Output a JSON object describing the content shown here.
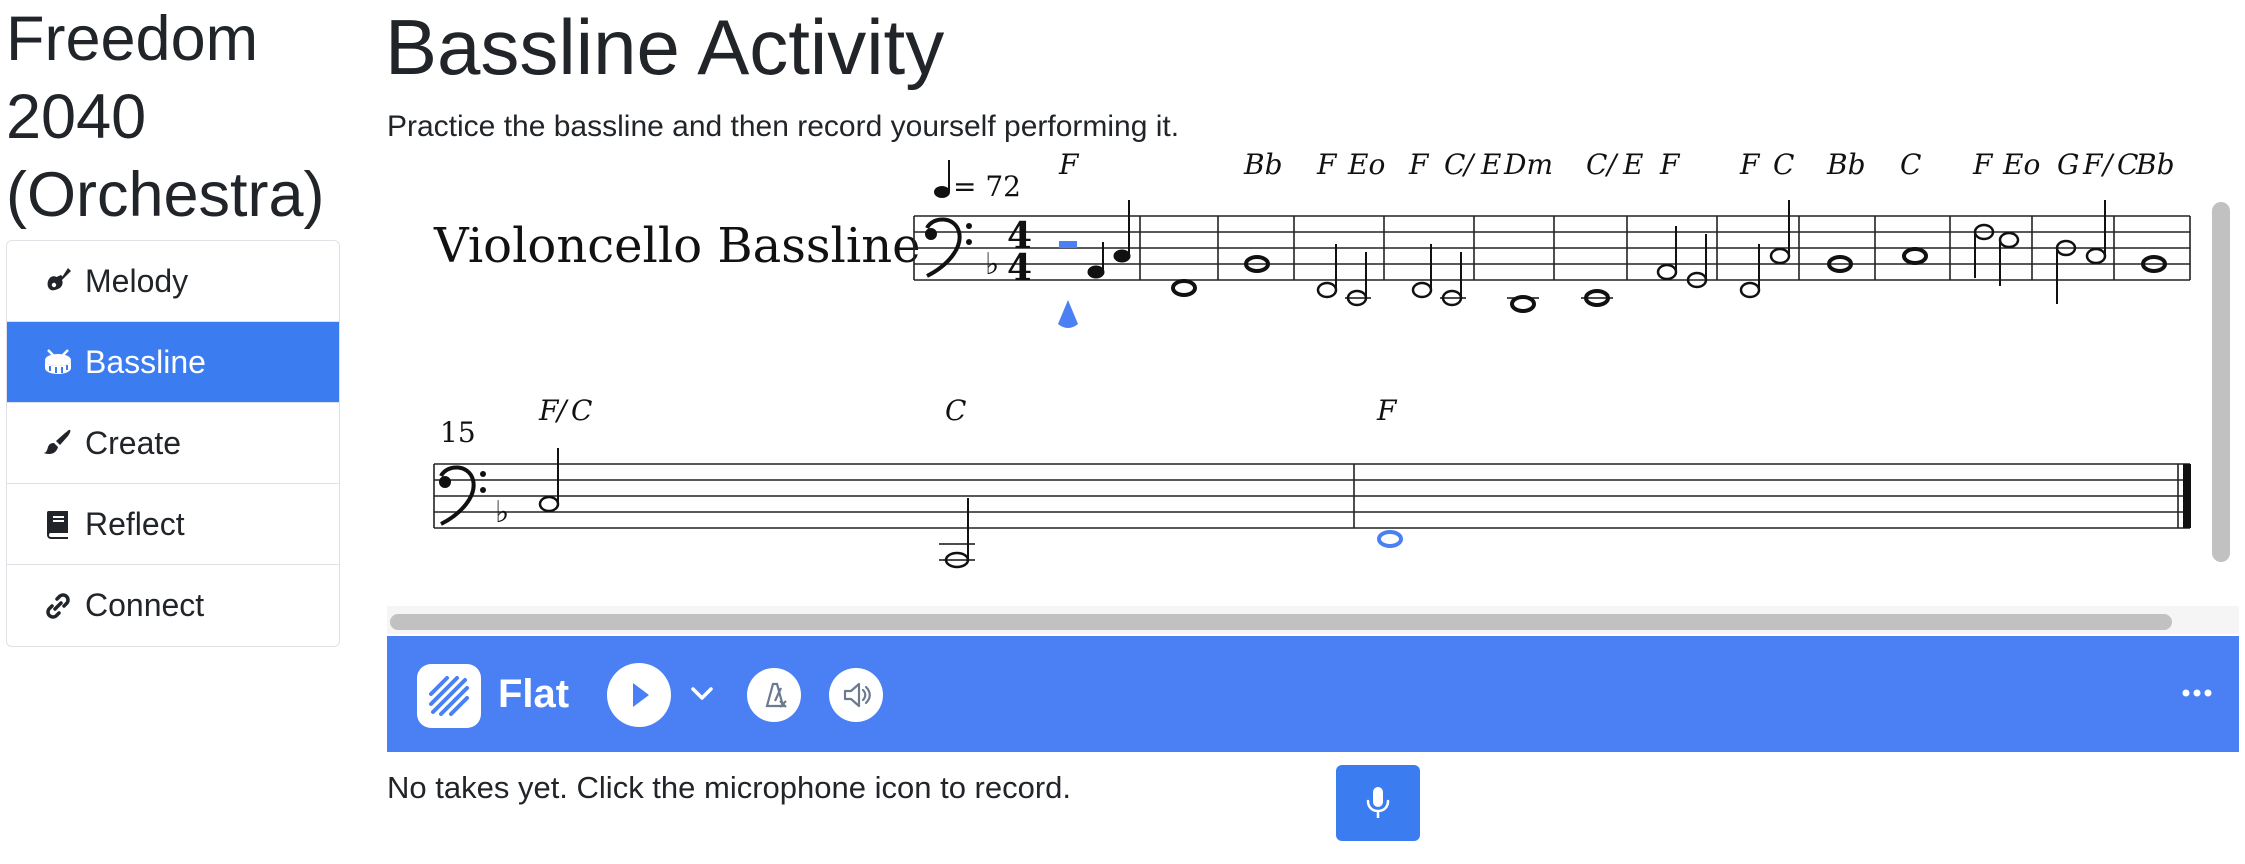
{
  "app": {
    "title": "Freedom 2040 (Orchestra)"
  },
  "sidebar": {
    "items": [
      {
        "label": "Melody",
        "icon": "guitar-icon",
        "active": false
      },
      {
        "label": "Bassline",
        "icon": "drum-icon",
        "active": true
      },
      {
        "label": "Create",
        "icon": "paintbrush-icon",
        "active": false
      },
      {
        "label": "Reflect",
        "icon": "book-icon",
        "active": false
      },
      {
        "label": "Connect",
        "icon": "link-icon",
        "active": false
      }
    ]
  },
  "main": {
    "title": "Bassline Activity",
    "instructions": "Practice the bassline and then record yourself performing it.",
    "score": {
      "instrument": "Violoncello Bassline",
      "tempo": "= 72",
      "time_signature": "4/4",
      "measure_number": "15",
      "chords_line1": [
        "F",
        "Bb",
        "F",
        "Eo",
        "F",
        "C",
        "/",
        "E",
        "Dm",
        "C",
        "/",
        "E",
        "F",
        "F",
        "C",
        "Bb",
        "C",
        "F",
        "Eo",
        "G",
        "F",
        "/",
        "C",
        "Bb"
      ],
      "chords_line2": [
        "F",
        "/",
        "C",
        "C",
        "F"
      ]
    },
    "player": {
      "brand": "Flat",
      "accent_color": "#4a80f4"
    },
    "recording": {
      "status": "No takes yet. Click the microphone icon to record."
    }
  }
}
